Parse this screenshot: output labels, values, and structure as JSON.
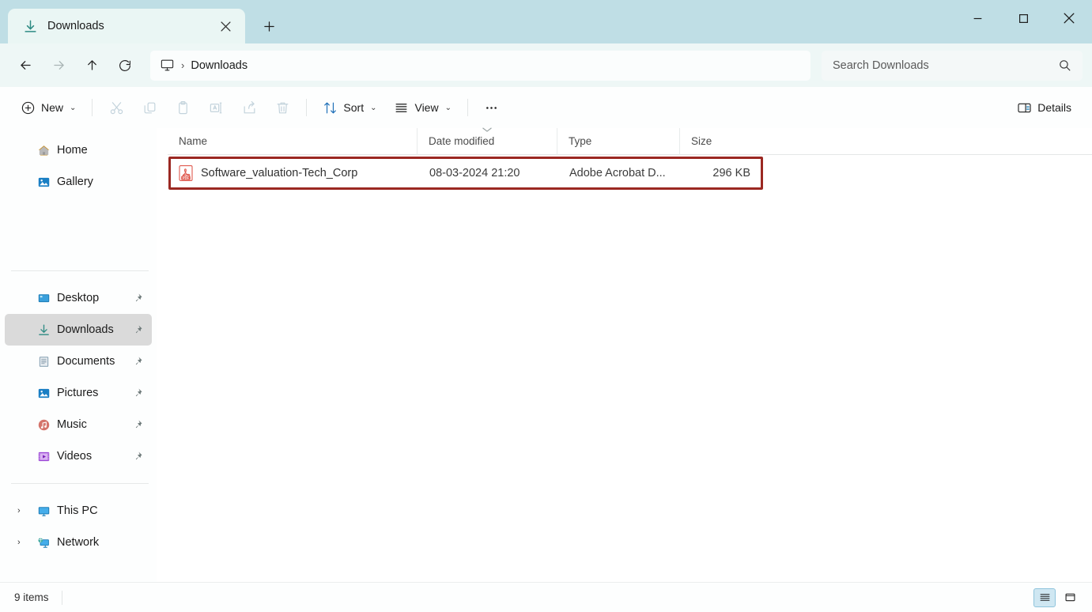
{
  "window": {
    "controls": {
      "minimize_label": "Minimize",
      "maximize_label": "Maximize",
      "close_label": "Close"
    }
  },
  "tabs": [
    {
      "title": "Downloads",
      "icon": "downloads-arrow-icon",
      "close_label": "Close tab"
    }
  ],
  "new_tab_label": "+",
  "nav": {
    "back_label": "Back",
    "forward_label": "Forward",
    "up_label": "Up to parent",
    "refresh_label": "Refresh",
    "address": {
      "root_icon": "this-pc-icon",
      "separator": "›",
      "crumbs": [
        "Downloads"
      ]
    },
    "search": {
      "placeholder": "Search Downloads",
      "value": "",
      "icon": "search-icon"
    }
  },
  "toolbar": {
    "new_label": "New",
    "cut_label": "Cut",
    "copy_label": "Copy",
    "paste_label": "Paste",
    "rename_label": "Rename",
    "share_label": "Share",
    "delete_label": "Delete",
    "sort_label": "Sort",
    "view_label": "View",
    "more_label": "See more",
    "details_label": "Details",
    "chevron": "⌄"
  },
  "sidebar": {
    "top_items": [
      {
        "label": "Home",
        "icon": "home-icon",
        "pinned": false,
        "selected": false
      },
      {
        "label": "Gallery",
        "icon": "gallery-icon",
        "pinned": false,
        "selected": false
      }
    ],
    "quick_access": [
      {
        "label": "Desktop",
        "icon": "desktop-icon",
        "pinned": true,
        "selected": false
      },
      {
        "label": "Downloads",
        "icon": "downloads-arrow-icon",
        "pinned": true,
        "selected": true
      },
      {
        "label": "Documents",
        "icon": "documents-icon",
        "pinned": true,
        "selected": false
      },
      {
        "label": "Pictures",
        "icon": "pictures-icon",
        "pinned": true,
        "selected": false
      },
      {
        "label": "Music",
        "icon": "music-icon",
        "pinned": true,
        "selected": false
      },
      {
        "label": "Videos",
        "icon": "videos-icon",
        "pinned": true,
        "selected": false
      }
    ],
    "tree_items": [
      {
        "label": "This PC",
        "icon": "this-pc-icon",
        "chevron": "›"
      },
      {
        "label": "Network",
        "icon": "network-icon",
        "chevron": "›"
      }
    ]
  },
  "columns": [
    {
      "key": "name",
      "label": "Name",
      "sorted": false
    },
    {
      "key": "date",
      "label": "Date modified",
      "sorted": true
    },
    {
      "key": "type",
      "label": "Type",
      "sorted": false
    },
    {
      "key": "size",
      "label": "Size",
      "sorted": false
    }
  ],
  "files": [
    {
      "name": "Software_valuation-Tech_Corp",
      "date_modified": "08-03-2024 21:20",
      "type": "Adobe Acrobat D...",
      "size": "296 KB",
      "icon": "pdf-file-icon",
      "highlighted": true
    }
  ],
  "status": {
    "item_count": "9 items",
    "view_details_label": "Details view",
    "view_tiles_label": "Large icons view"
  },
  "colors": {
    "titlebar": "#bfdee5",
    "tab_active": "#eaf6f4",
    "navbar": "#eef7f6",
    "accent_teal": "#2e8b83",
    "highlight_red": "#9b2822",
    "selected_nav": "#dadada",
    "view_active": "#cfe7f2"
  }
}
